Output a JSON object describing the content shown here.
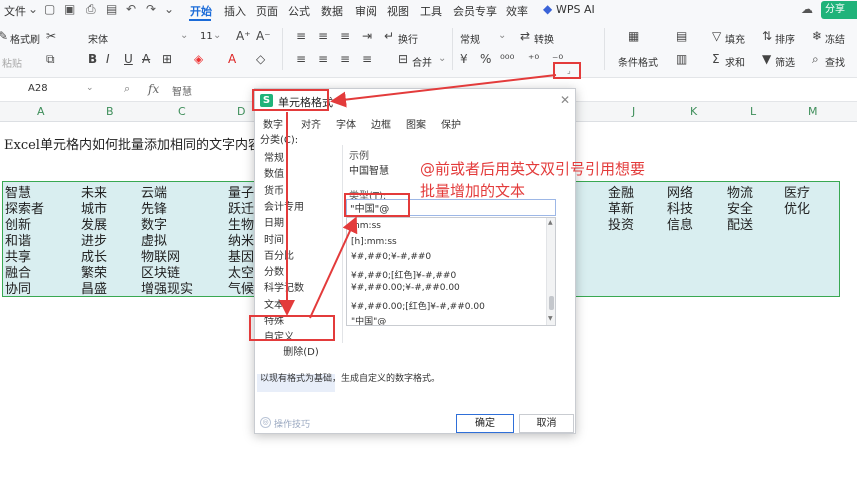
{
  "menubar": {
    "file": "文件",
    "tabs": [
      "开始",
      "插入",
      "页面",
      "公式",
      "数据",
      "审阅",
      "视图",
      "工具",
      "会员专享",
      "效率"
    ],
    "ai": "WPS AI",
    "share": "分享"
  },
  "ribbon": {
    "format_painter": "格式刷",
    "paste": "粘贴",
    "font_name": "宋体",
    "font_size": "11",
    "wrap": "换行",
    "number_format": "常规",
    "convert": "转换",
    "merge": "合并",
    "conditional_format": "条件格式",
    "fill": "填充",
    "sort": "排序",
    "freeze": "冻结",
    "sum": "求和",
    "filter": "筛选",
    "find": "查找"
  },
  "formula_bar": {
    "cell_ref": "A28",
    "fx": "fx",
    "content": "智慧"
  },
  "columns": [
    "A",
    "B",
    "C",
    "D",
    "J",
    "K",
    "L",
    "M"
  ],
  "sheet": {
    "title": "Excel单元格内如何批量添加相同的文字内容?",
    "col_a": [
      "智慧",
      "探索者",
      "创新",
      "和谐",
      "共享",
      "融合",
      "协同"
    ],
    "col_b": [
      "未来",
      "城市",
      "发展",
      "进步",
      "成长",
      "繁荣",
      "昌盛"
    ],
    "col_c": [
      "云端",
      "先锋",
      "数字",
      "虚拟",
      "物联网",
      "区块链",
      "增强现实"
    ],
    "col_d": [
      "量子",
      "跃迁",
      "生物",
      "纳米",
      "基因",
      "太空",
      "气候"
    ],
    "col_j": [
      "金融",
      "革新",
      "投资"
    ],
    "col_k": [
      "网络",
      "科技",
      "信息"
    ],
    "col_l": [
      "物流",
      "安全",
      "配送"
    ],
    "col_m": [
      "医疗",
      "优化"
    ]
  },
  "dialog": {
    "title": "单元格格式",
    "tabs": [
      "数字",
      "对齐",
      "字体",
      "边框",
      "图案",
      "保护"
    ],
    "category_label": "分类(C):",
    "categories": [
      "常规",
      "数值",
      "货币",
      "会计专用",
      "日期",
      "时间",
      "百分比",
      "分数",
      "科学记数",
      "文本",
      "特殊",
      "自定义"
    ],
    "sample_label": "示例",
    "sample_value": "中国智慧",
    "type_label": "类型(T):",
    "type_value": "\"中国\"@",
    "formats": [
      "mm:ss",
      "[h]:mm:ss",
      "¥#,##0;¥-#,##0",
      "¥#,##0;[红色]¥-#,##0",
      "¥#,##0.00;¥-#,##0.00",
      "¥#,##0.00;[红色]¥-#,##0.00",
      "\"中国\"@"
    ],
    "delete": "删除(D)",
    "description": "以现有格式为基础，生成自定义的数字格式。",
    "tips": "操作技巧",
    "ok": "确定",
    "cancel": "取消"
  },
  "annotation": {
    "line1": "@前或者后用英文双引号引用想要",
    "line2": "批量增加的文本",
    "color": "#e33b3b"
  }
}
